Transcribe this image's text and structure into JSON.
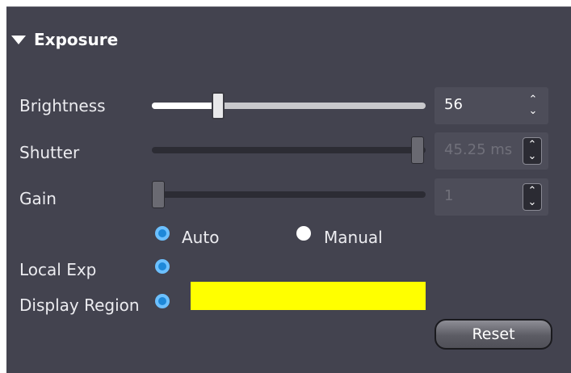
{
  "section": {
    "title": "Exposure"
  },
  "brightness": {
    "label": "Brightness",
    "value": "56",
    "slider_fraction": 0.24,
    "enabled": true
  },
  "shutter": {
    "label": "Shutter",
    "value": "45.25 ms",
    "slider_fraction": 1.0,
    "enabled": false
  },
  "gain": {
    "label": "Gain",
    "value": "1",
    "slider_fraction": 0.0,
    "enabled": false
  },
  "mode": {
    "auto_label": "Auto",
    "manual_label": "Manual",
    "selected": "Auto"
  },
  "local_exp": {
    "label": "Local Exp",
    "checked": true
  },
  "display_region": {
    "label": "Display Region",
    "checked": true,
    "color": "#ffff00"
  },
  "reset": {
    "label": "Reset"
  },
  "icons": {
    "collapse": "triangle-down-icon",
    "spinner": "up-down-chevron-icon"
  },
  "colors": {
    "panel_bg": "#43434f",
    "accent": "#1e88d8"
  }
}
